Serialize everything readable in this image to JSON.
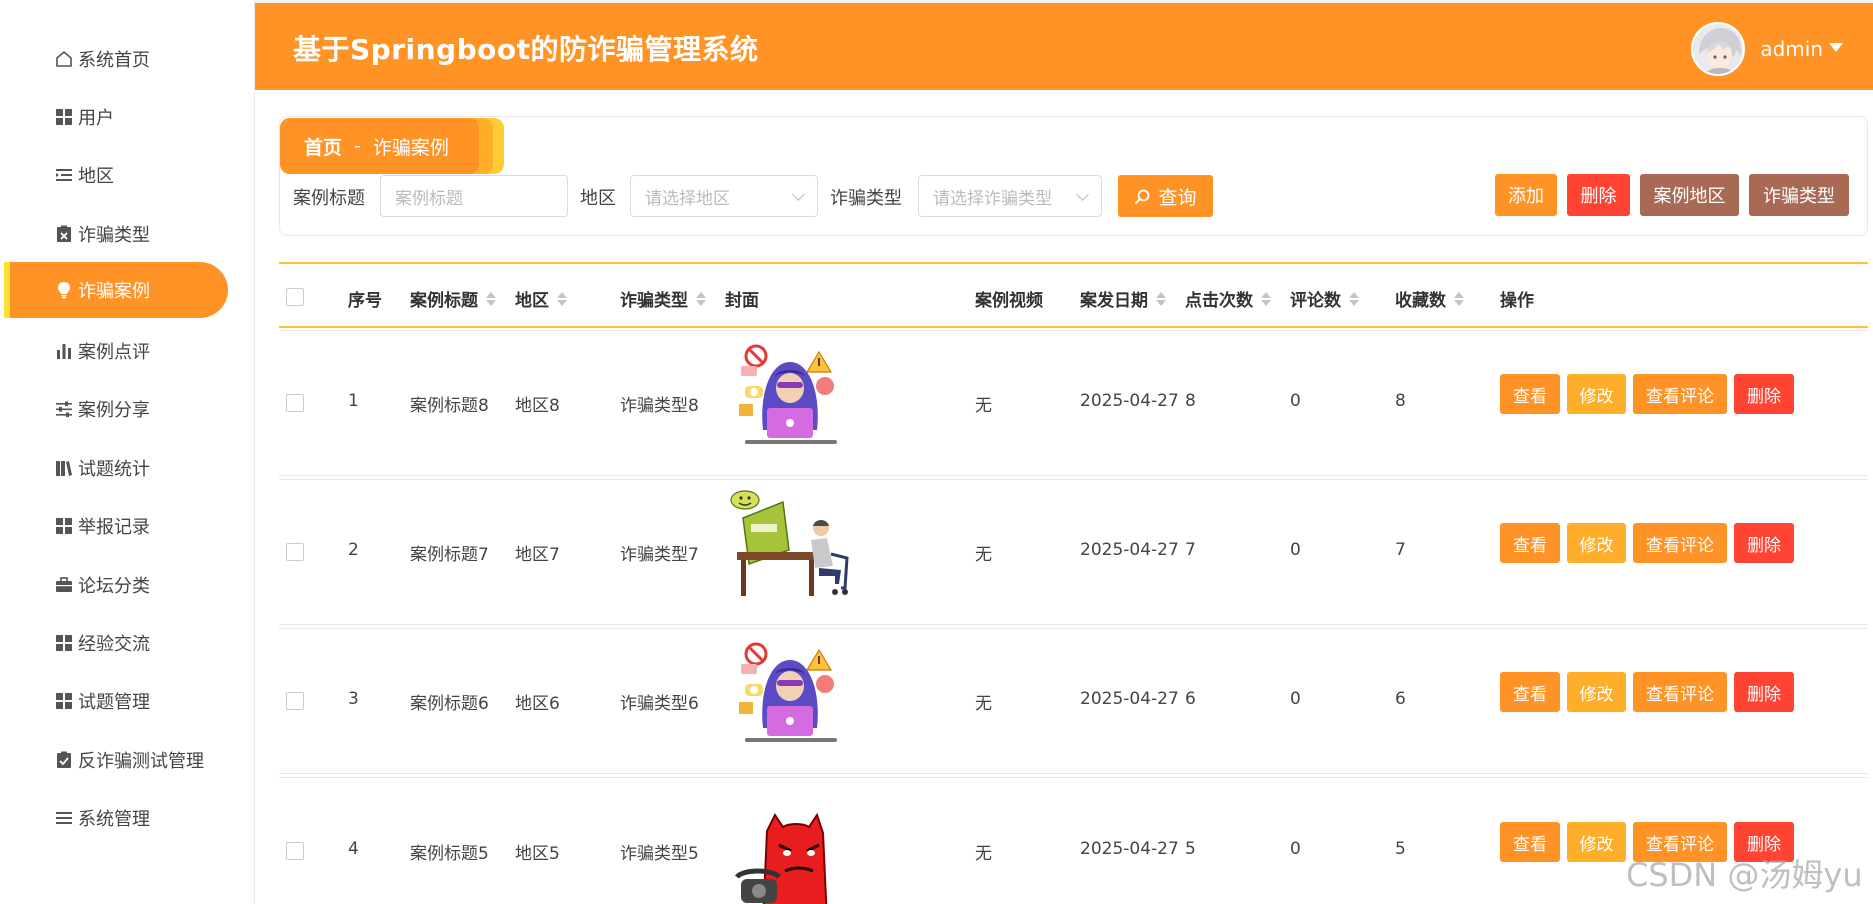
{
  "header": {
    "title": "基于Springboot的防诈骗管理系统",
    "username": "admin"
  },
  "sidebar": {
    "items": [
      {
        "label": "系统首页",
        "icon": "home-icon"
      },
      {
        "label": "用户",
        "icon": "grid-icon"
      },
      {
        "label": "地区",
        "icon": "list-indent-icon"
      },
      {
        "label": "诈骗类型",
        "icon": "clipboard-x-icon"
      },
      {
        "label": "诈骗案例",
        "icon": "lightbulb-icon",
        "active": true
      },
      {
        "label": "案例点评",
        "icon": "bar-chart-icon"
      },
      {
        "label": "案例分享",
        "icon": "sliders-icon"
      },
      {
        "label": "试题统计",
        "icon": "books-icon"
      },
      {
        "label": "举报记录",
        "icon": "grid-icon"
      },
      {
        "label": "论坛分类",
        "icon": "briefcase-icon"
      },
      {
        "label": "经验交流",
        "icon": "grid-icon"
      },
      {
        "label": "试题管理",
        "icon": "grid-icon"
      },
      {
        "label": "反诈骗测试管理",
        "icon": "clipboard-check-icon"
      },
      {
        "label": "系统管理",
        "icon": "menu-icon"
      }
    ]
  },
  "breadcrumb": {
    "home": "首页",
    "separator": "-",
    "current": "诈骗案例"
  },
  "filters": {
    "title_label": "案例标题",
    "title_placeholder": "案例标题",
    "region_label": "地区",
    "region_placeholder": "请选择地区",
    "type_label": "诈骗类型",
    "type_placeholder": "请选择诈骗类型",
    "search_label": "查询"
  },
  "toolbar": {
    "add": "添加",
    "delete": "删除",
    "case_region": "案例地区",
    "fraud_type": "诈骗类型"
  },
  "table": {
    "columns": {
      "index": "序号",
      "title": "案例标题",
      "region": "地区",
      "type": "诈骗类型",
      "cover": "封面",
      "video": "案例视频",
      "date": "案发日期",
      "clicks": "点击次数",
      "comments": "评论数",
      "favorites": "收藏数",
      "actions": "操作"
    },
    "actions": {
      "view": "查看",
      "edit": "修改",
      "view_comments": "查看评论",
      "delete": "删除"
    },
    "rows": [
      {
        "index": "1",
        "title": "案例标题8",
        "region": "地区8",
        "type": "诈骗类型8",
        "cover": "hacker-laptop-image",
        "video": "无",
        "date": "2025-04-27",
        "clicks": "8",
        "comments": "0",
        "favorites": "8"
      },
      {
        "index": "2",
        "title": "案例标题7",
        "region": "地区7",
        "type": "诈骗类型7",
        "cover": "loan-trap-image",
        "video": "无",
        "date": "2025-04-27",
        "clicks": "7",
        "comments": "0",
        "favorites": "7"
      },
      {
        "index": "3",
        "title": "案例标题6",
        "region": "地区6",
        "type": "诈骗类型6",
        "cover": "hacker-laptop-image",
        "video": "无",
        "date": "2025-04-27",
        "clicks": "6",
        "comments": "0",
        "favorites": "6"
      },
      {
        "index": "4",
        "title": "案例标题5",
        "region": "地区5",
        "type": "诈骗类型5",
        "cover": "phone-devil-image",
        "video": "无",
        "date": "2025-04-27",
        "clicks": "5",
        "comments": "0",
        "favorites": "5"
      }
    ]
  },
  "watermark": "CSDN @汤姆yu",
  "colors": {
    "primary": "#ff9326",
    "secondary": "#ffae2a",
    "danger": "#ff4433",
    "brown": "#a86a55",
    "accent_yellow": "#ffc428"
  }
}
